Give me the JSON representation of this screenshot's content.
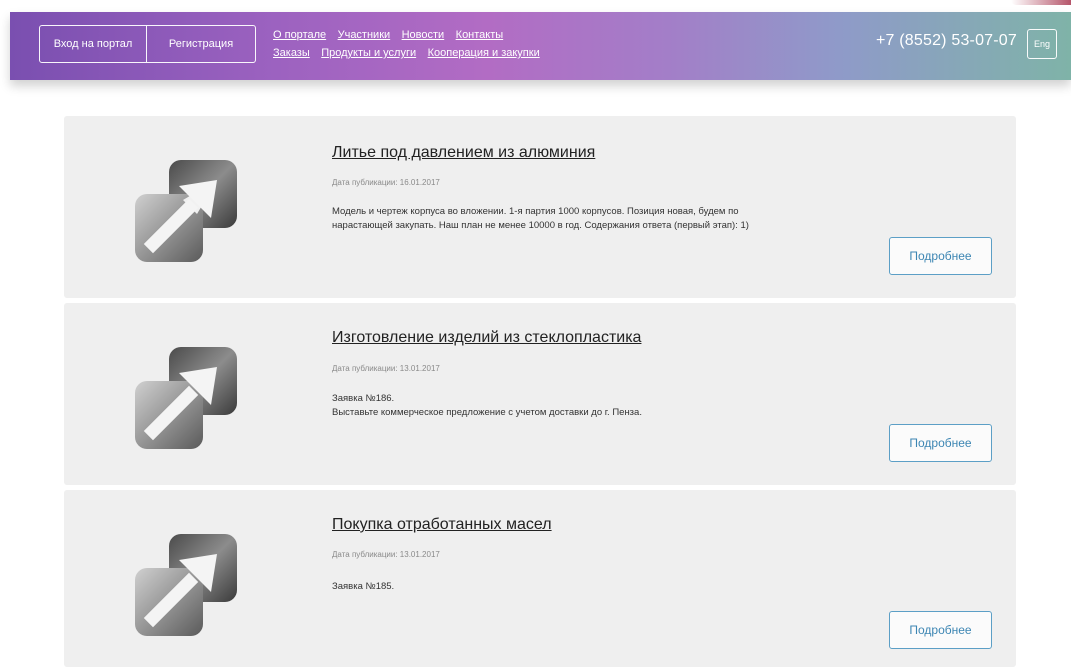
{
  "header": {
    "auth": {
      "login_label": "Вход на портал",
      "register_label": "Регистрация"
    },
    "nav_row1": [
      "О портале",
      "Участники",
      "Новости",
      "Контакты"
    ],
    "nav_row2": [
      "Заказы",
      "Продукты и услуги",
      "Кооперация и закупки"
    ],
    "phone": "+7 (8552) 53-07-07",
    "lang_label": "Eng"
  },
  "cards": [
    {
      "title": "Литье под давлением из алюминия",
      "date": "Дата публикации: 16.01.2017",
      "text_lines": [
        "Модель и чертеж корпуса во вложении. 1-я партия 1000 корпусов. Позиция новая, будем по",
        "нарастающей закупать. Наш план не менее 10000 в год. Содержания ответа (первый этап): 1)"
      ],
      "icon": "arrow-up-right-icon",
      "more_label": "Подробнее"
    },
    {
      "title": "Изготовление изделий из стеклопластика",
      "date": "Дата публикации: 13.01.2017",
      "text_lines": [
        "Заявка №186.",
        "Выставьте коммерческое предложение с учетом доставки до г. Пенза."
      ],
      "icon": "arrow-up-right-icon",
      "more_label": "Подробнее"
    },
    {
      "title": "Покупка отработанных масел",
      "date": "Дата публикации: 13.01.2017",
      "text_lines": [
        "Заявка №185."
      ],
      "icon": "arrow-up-right-icon",
      "more_label": "Подробнее"
    }
  ],
  "colors": {
    "header_gradient": [
      "#7a4fb0",
      "#b26cc4",
      "#8f9ac9",
      "#7fb3a8"
    ],
    "card_bg": "#efefef",
    "button_accent": "#3d86b3"
  }
}
